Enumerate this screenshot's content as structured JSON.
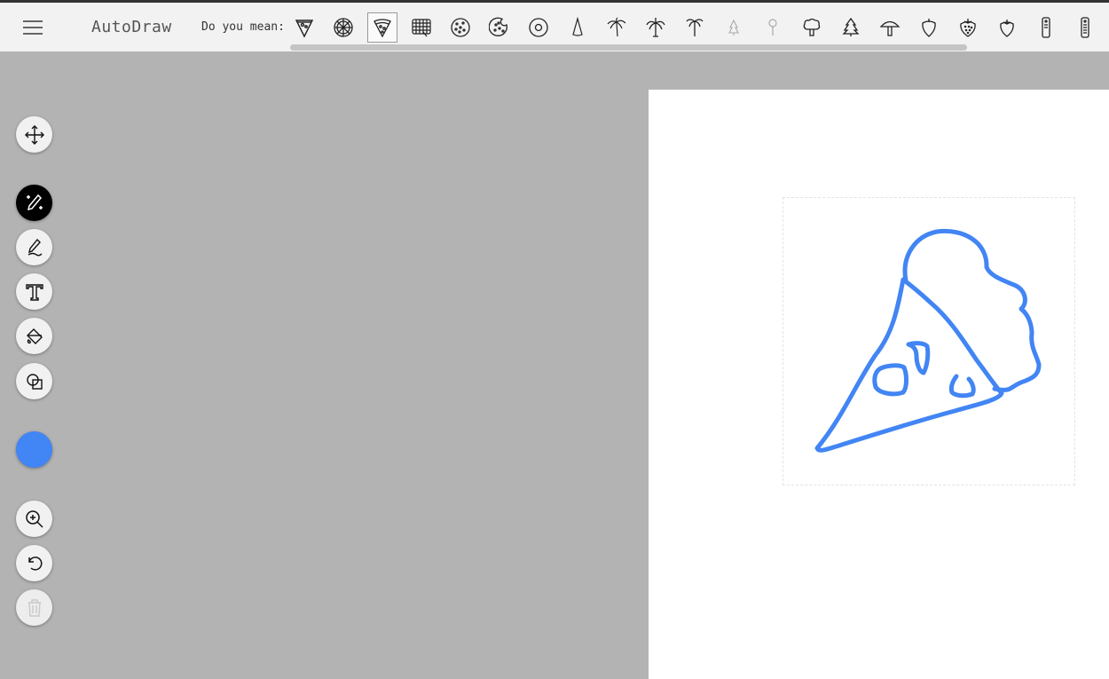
{
  "app": {
    "title": "AutoDraw"
  },
  "suggestions": {
    "label": "Do you mean:",
    "items": [
      {
        "icon": "pizza-slice-icon",
        "selected": false
      },
      {
        "icon": "pizza-icon",
        "selected": false
      },
      {
        "icon": "pizza-slice-alt-icon",
        "selected": true
      },
      {
        "icon": "waffle-icon",
        "selected": false
      },
      {
        "icon": "cookie-icon",
        "selected": false
      },
      {
        "icon": "cookie-bitten-icon",
        "selected": false
      },
      {
        "icon": "donut-icon",
        "selected": false
      },
      {
        "icon": "cone-icon",
        "selected": false
      },
      {
        "icon": "palm-tree-icon",
        "selected": false
      },
      {
        "icon": "palm-tree-alt-icon",
        "selected": false
      },
      {
        "icon": "palm-tree-tall-icon",
        "selected": false
      },
      {
        "icon": "tree-faded-icon",
        "selected": false
      },
      {
        "icon": "lollipop-icon",
        "selected": false
      },
      {
        "icon": "broccoli-icon",
        "selected": false
      },
      {
        "icon": "pine-tree-icon",
        "selected": false
      },
      {
        "icon": "mushroom-icon",
        "selected": false
      },
      {
        "icon": "strawberry-outline-icon",
        "selected": false
      },
      {
        "icon": "strawberry-icon",
        "selected": false
      },
      {
        "icon": "strawberry-alt-icon",
        "selected": false
      },
      {
        "icon": "remote-control-icon",
        "selected": false
      },
      {
        "icon": "remote-control-alt-icon",
        "selected": false
      }
    ]
  },
  "tools": [
    {
      "name": "select-tool",
      "icon": "move-arrows-icon"
    },
    {
      "name": "autodraw-tool",
      "icon": "magic-pencil-icon",
      "active": true
    },
    {
      "name": "draw-tool",
      "icon": "pencil-icon"
    },
    {
      "name": "type-tool",
      "icon": "text-t-icon"
    },
    {
      "name": "fill-tool",
      "icon": "paint-bucket-icon"
    },
    {
      "name": "shape-tool",
      "icon": "shapes-icon"
    },
    {
      "name": "zoom-tool",
      "icon": "zoom-in-icon"
    },
    {
      "name": "undo-tool",
      "icon": "undo-icon"
    },
    {
      "name": "delete-tool",
      "icon": "trash-icon",
      "disabled": true
    }
  ],
  "color": {
    "current": "#4285f4"
  },
  "colors": {
    "stroke": "#4285f4",
    "canvas": "#ffffff",
    "workspace": "#b3b3b3"
  }
}
